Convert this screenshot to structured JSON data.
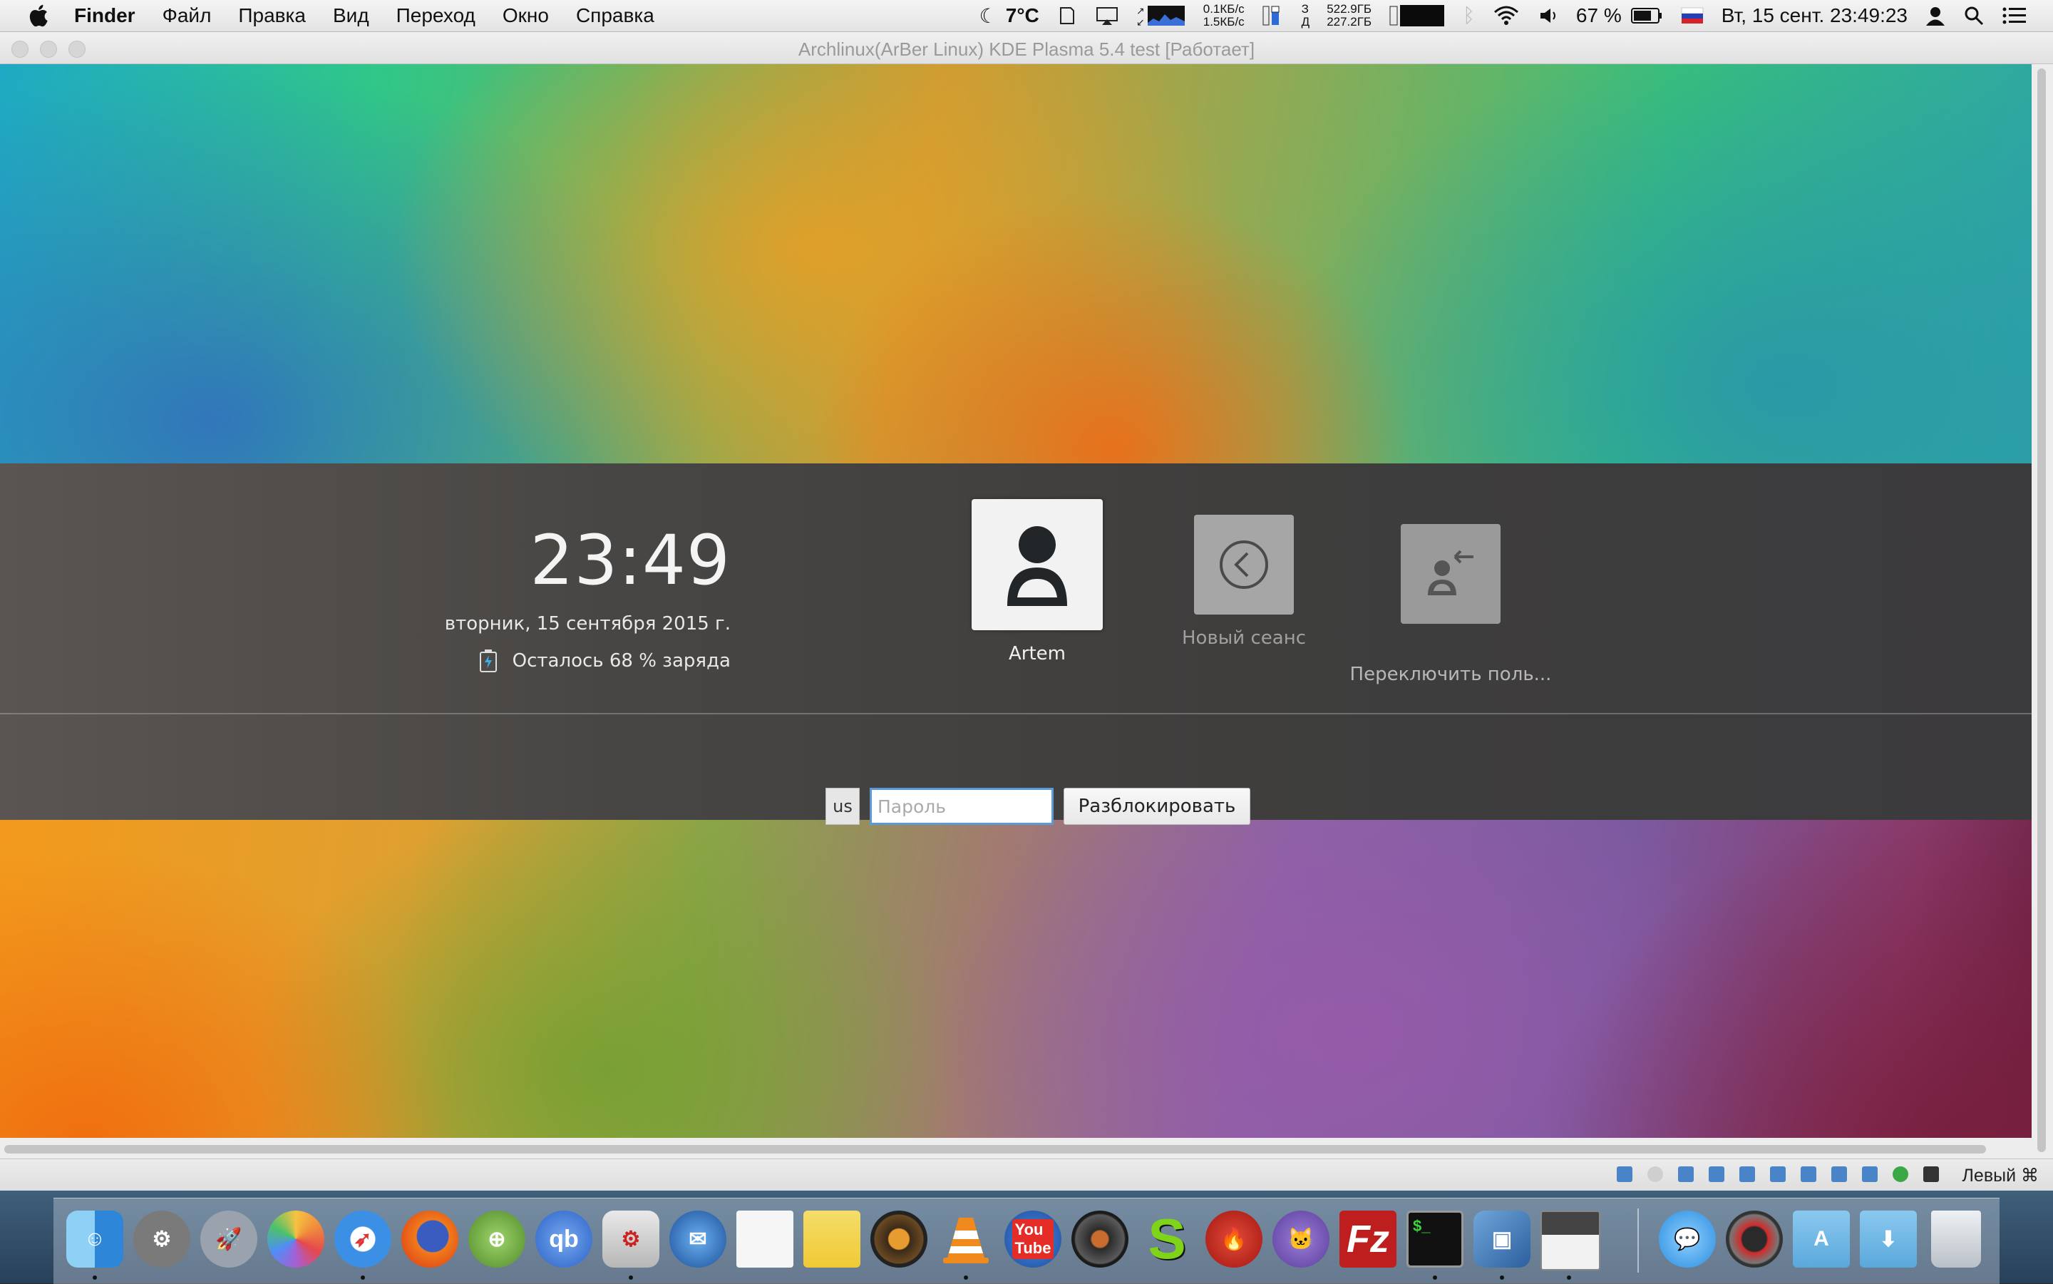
{
  "menubar": {
    "app_name": "Finder",
    "menus": [
      "Файл",
      "Правка",
      "Вид",
      "Переход",
      "Окно",
      "Справка"
    ],
    "weather": "7°C",
    "net_down": "0.1КБ/с",
    "net_up": "1.5КБ/с",
    "mem_label_1": "З",
    "mem_label_2": "Д",
    "disk_1": "522.9ГБ",
    "disk_2": "227.2ГБ",
    "battery_pct": "67 %",
    "datetime": "Вт, 15 сент.  23:49:23"
  },
  "vm_window": {
    "title": "Archlinux(ArBer Linux) KDE Plasma 5.4 test [Работает]",
    "host_key": "Левый ⌘"
  },
  "lock_screen": {
    "time": "23:49",
    "date": "вторник, 15 сентября 2015 г.",
    "battery_text": "Осталось 68 % заряда",
    "users": [
      {
        "label": "Artem"
      },
      {
        "label": "Новый сеанс"
      },
      {
        "label": "Переключить поль..."
      }
    ],
    "keyboard_layout": "us",
    "password_placeholder": "Пароль",
    "unlock_label": "Разблокировать"
  },
  "dock": {
    "icons": [
      "finder-icon",
      "system-preferences-icon",
      "launchpad-icon",
      "photos-icon",
      "safari-icon",
      "firefox-icon",
      "network-globe-icon",
      "qbittorrent-icon",
      "transmission-icon",
      "thunderbird-icon",
      "textedit-icon",
      "notes-icon",
      "speaker-icon",
      "vlc-icon",
      "youtube-icon",
      "media-player-icon",
      "script-s-icon",
      "fire-app-icon",
      "github-icon",
      "filezilla-icon",
      "terminal-icon",
      "virtualbox-icon",
      "screenshot-icon",
      "messages-icon",
      "photo-booth-icon",
      "applications-folder-icon",
      "downloads-folder-icon",
      "trash-icon"
    ]
  }
}
